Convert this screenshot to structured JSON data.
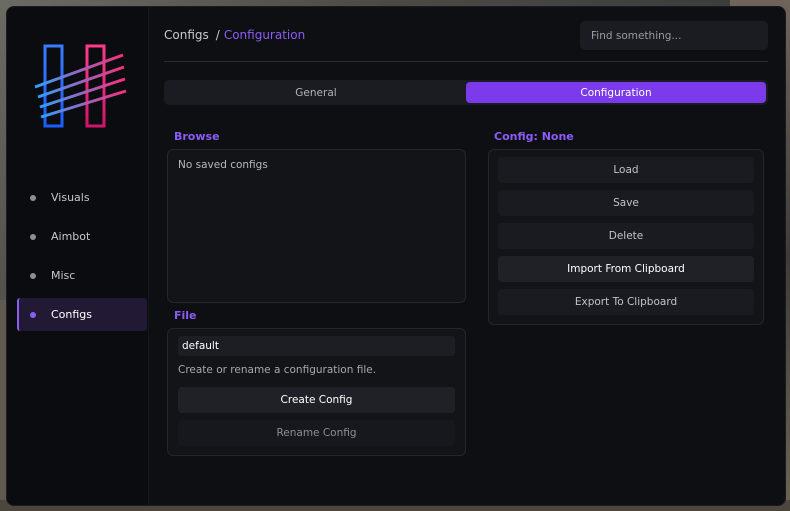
{
  "sidebar": {
    "items": [
      {
        "label": "Visuals",
        "active": false
      },
      {
        "label": "Aimbot",
        "active": false
      },
      {
        "label": "Misc",
        "active": false
      },
      {
        "label": "Configs",
        "active": true
      }
    ]
  },
  "header": {
    "breadcrumb_root": "Configs",
    "breadcrumb_sep": "/",
    "breadcrumb_current": "Configuration",
    "search_placeholder": "Find something..."
  },
  "tabs": [
    {
      "label": "General",
      "active": false
    },
    {
      "label": "Configuration",
      "active": true
    }
  ],
  "browse": {
    "title": "Browse",
    "empty_text": "No saved configs"
  },
  "file": {
    "title": "File",
    "value": "default",
    "hint": "Create or rename a configuration file.",
    "create_label": "Create Config",
    "rename_label": "Rename Config"
  },
  "config": {
    "title": "Config: None",
    "load_label": "Load",
    "save_label": "Save",
    "delete_label": "Delete",
    "import_label": "Import From Clipboard",
    "export_label": "Export To Clipboard"
  },
  "colors": {
    "accent": "#8b5cf6",
    "accent_strong": "#7c3aed",
    "background": "#0e0f13"
  }
}
